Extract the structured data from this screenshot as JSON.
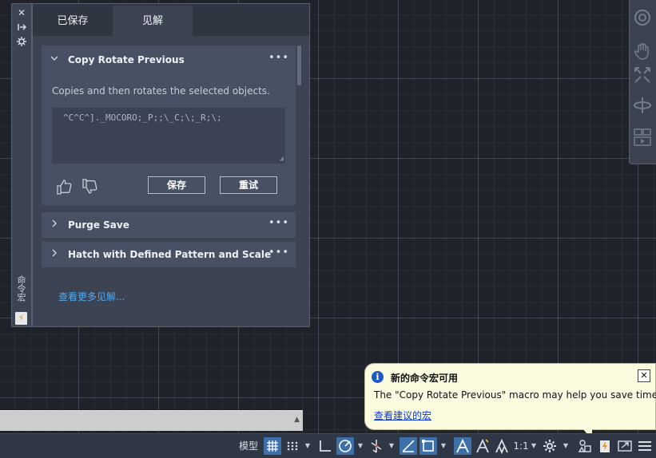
{
  "sidebar": {
    "close_glyph": "✕",
    "vertical_label": "命令宏"
  },
  "tabs": [
    {
      "label": "已保存"
    },
    {
      "label": "见解"
    }
  ],
  "cards": [
    {
      "title": "Copy Rotate Previous",
      "expanded": true,
      "description": "Copies and then rotates the selected objects.",
      "macro": "^C^C^]._MOCORO;_P;;\\_C;\\;_R;\\;",
      "save_label": "保存",
      "retry_label": "重试"
    },
    {
      "title": "Purge Save",
      "expanded": false
    },
    {
      "title": "Hatch with Defined Pattern and Scale",
      "expanded": false
    }
  ],
  "see_more": "查看更多见解...",
  "notification": {
    "title": "新的命令宏可用",
    "message": "The \"Copy Rotate Previous\" macro may help you save time",
    "link": "查看建议的宏",
    "info_glyph": "i",
    "close_glyph": "✕"
  },
  "statusbar": {
    "model_label": "模型",
    "scale_label": "1:1"
  },
  "colors": {
    "canvas": "#1f2229",
    "panel": "#3c4454",
    "card": "#485163",
    "accent": "#3d6fa8",
    "link": "#52a8ef",
    "notification_bg": "#fbfbe0"
  }
}
